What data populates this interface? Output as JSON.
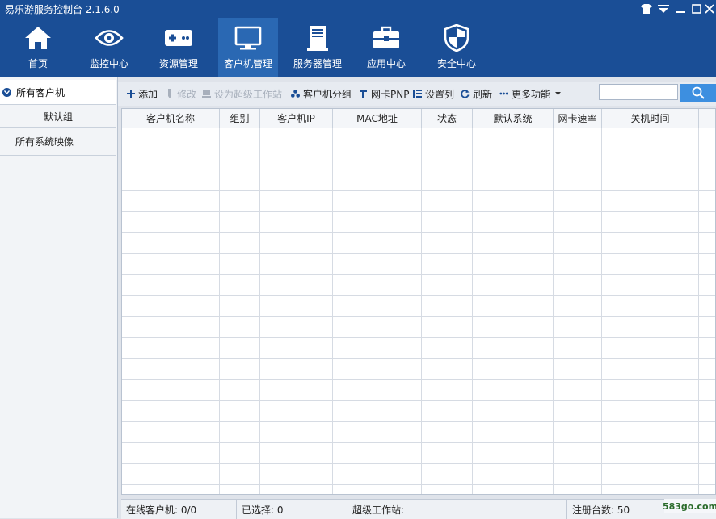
{
  "window": {
    "title": "易乐游服务控制台 2.1.6.0"
  },
  "nav": [
    {
      "label": "首页",
      "icon": "home-icon"
    },
    {
      "label": "监控中心",
      "icon": "eye-icon"
    },
    {
      "label": "资源管理",
      "icon": "gamepad-icon"
    },
    {
      "label": "客户机管理",
      "icon": "monitor-icon",
      "active": true
    },
    {
      "label": "服务器管理",
      "icon": "server-icon"
    },
    {
      "label": "应用中心",
      "icon": "toolbox-icon"
    },
    {
      "label": "安全中心",
      "icon": "shield-icon"
    }
  ],
  "sidebar": {
    "root": "所有客户机",
    "default_group": "默认组",
    "images": "所有系统映像"
  },
  "toolbar": {
    "add": "添加",
    "edit": "修改",
    "super_ws": "设为超级工作站",
    "group": "客户机分组",
    "pnp": "网卡PNP",
    "columns": "设置列",
    "refresh": "刷新",
    "more": "更多功能",
    "search_value": ""
  },
  "table": {
    "columns": [
      "客户机名称",
      "组别",
      "客户机IP",
      "MAC地址",
      "状态",
      "默认系统",
      "网卡速率",
      "关机时间"
    ],
    "rows": []
  },
  "status": {
    "online": "在线客户机: 0/0",
    "selected": "已选择: 0",
    "super_ws": "超级工作站:",
    "registered": "注册台数: 50"
  },
  "watermark": "583go.com",
  "colors": {
    "banner": "#1a4e96",
    "nav_active": "#2a68b3",
    "search_button": "#3d8fe0"
  }
}
